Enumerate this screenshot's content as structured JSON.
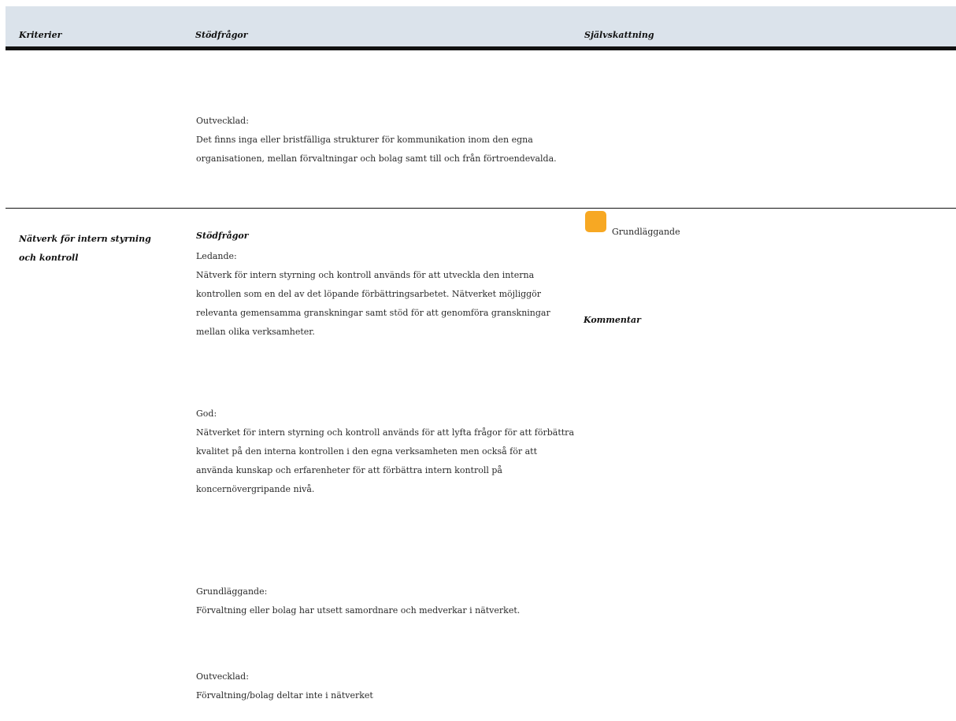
{
  "header": {
    "col_criteria": "Kriterier",
    "col_questions": "Stödfrågor",
    "col_assessment": "Självskattning"
  },
  "previous_row": {
    "undeveloped_label": "Outvecklad:",
    "undeveloped_text": "Det finns inga eller bristfälliga strukturer för kommunikation inom den egna organisationen, mellan förvaltningar och bolag samt till och från förtroendevalda."
  },
  "row": {
    "criteria": "Nätverk för intern styrning och kontroll",
    "questions_heading": "Stödfrågor",
    "leading_label": "Ledande:",
    "leading_text": "Nätverk för intern styrning och kontroll används för att utveckla den interna kontrollen som en del av det löpande förbättringsarbetet. Nätverket möjliggör relevanta gemensamma granskningar samt stöd för att genomföra granskningar mellan olika verksamheter.",
    "good_label": "God:",
    "good_text": "Nätverket för intern styrning och kontroll används för att lyfta frågor för att förbättra kvalitet på den interna kontrollen i den egna verksamheten men också för att använda kunskap och erfarenheter för att förbättra intern kontroll på koncernövergripande nivå.",
    "basic_label": "Grundläggande:",
    "basic_text": "Förvaltning eller bolag har utsett samordnare och medverkar i nätverket.",
    "undeveloped_label": "Outvecklad:",
    "undeveloped_text": "Förvaltning/bolag deltar inte i nätverket",
    "rating_label": "Grundläggande",
    "rating_color": "#f7a823",
    "comment_label": "Kommentar"
  }
}
